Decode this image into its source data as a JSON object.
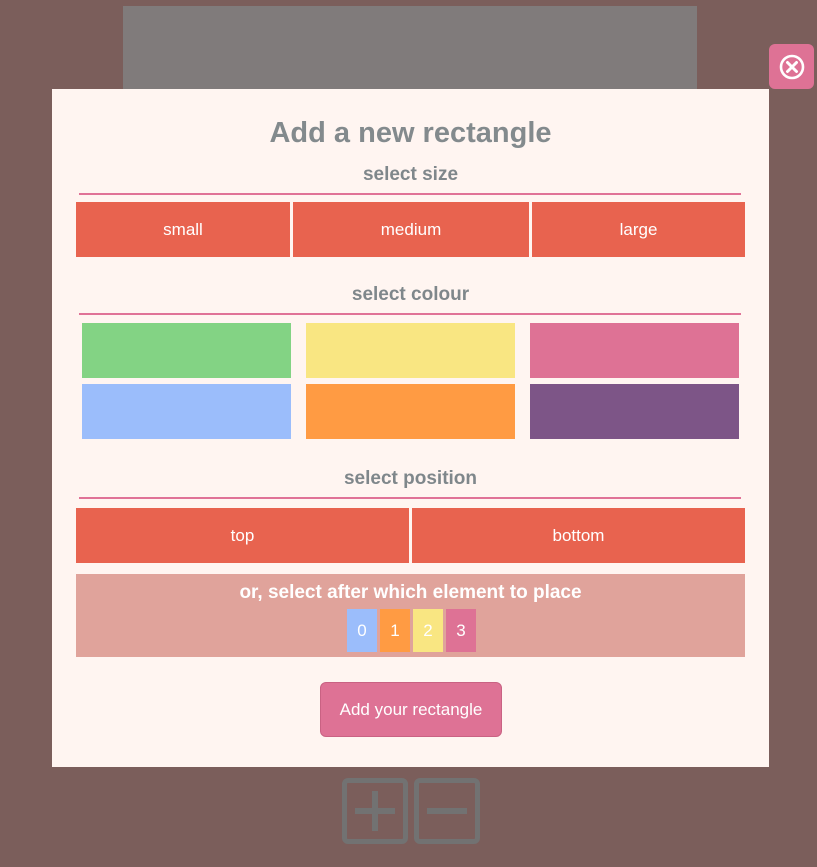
{
  "modal": {
    "title": "Add a new rectangle",
    "size_label": "select size",
    "sizes": [
      "small",
      "medium",
      "large"
    ],
    "colour_label": "select colour",
    "colours": [
      "#83d384",
      "#f9e682",
      "#de7295",
      "#9bbdfb",
      "#ff9b43",
      "#7d5587"
    ],
    "position_label": "select position",
    "positions": [
      "top",
      "bottom"
    ],
    "after_label": "or, select after which element to place",
    "elements": [
      {
        "label": "0",
        "color": "#9bbdfb"
      },
      {
        "label": "1",
        "color": "#ff9b43"
      },
      {
        "label": "2",
        "color": "#f9e682"
      },
      {
        "label": "3",
        "color": "#de7295"
      }
    ],
    "add_button": "Add your rectangle"
  },
  "icons": {
    "close": "close-circle-icon",
    "add": "plus-icon",
    "remove": "minus-icon"
  }
}
